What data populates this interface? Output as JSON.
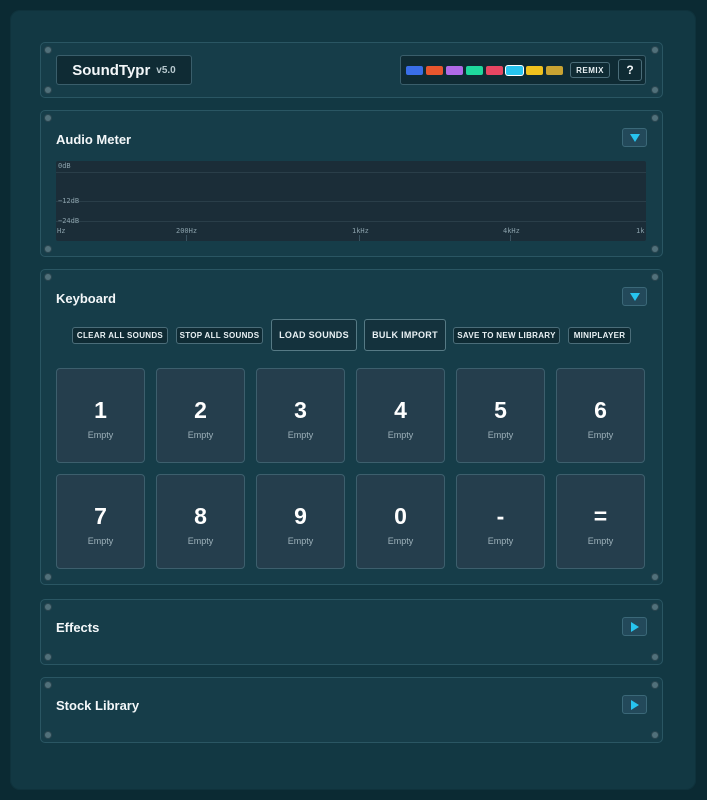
{
  "header": {
    "app_name": "SoundTypr",
    "version": "v5.0",
    "swatches": [
      "#3a6ee8",
      "#e8562e",
      "#b06ae8",
      "#1fd99d",
      "#e84663",
      "#27c4ef",
      "#f0c21e",
      "#c9a332"
    ],
    "selected_swatch": 5,
    "remix_label": "REMIX",
    "help_label": "?"
  },
  "audio_meter": {
    "title": "Audio Meter",
    "db_labels": [
      "0dB",
      "−12dB",
      "−24dB"
    ],
    "freq_labels": [
      "Hz",
      "200Hz",
      "1kHz",
      "4kHz",
      "1k"
    ]
  },
  "keyboard": {
    "title": "Keyboard",
    "actions": [
      "CLEAR ALL SOUNDS",
      "STOP ALL SOUNDS",
      "LOAD SOUNDS",
      "BULK IMPORT",
      "SAVE TO NEW LIBRARY",
      "MINIPLAYER"
    ],
    "keys": [
      {
        "label": "1",
        "status": "Empty"
      },
      {
        "label": "2",
        "status": "Empty"
      },
      {
        "label": "3",
        "status": "Empty"
      },
      {
        "label": "4",
        "status": "Empty"
      },
      {
        "label": "5",
        "status": "Empty"
      },
      {
        "label": "6",
        "status": "Empty"
      },
      {
        "label": "7",
        "status": "Empty"
      },
      {
        "label": "8",
        "status": "Empty"
      },
      {
        "label": "9",
        "status": "Empty"
      },
      {
        "label": "0",
        "status": "Empty"
      },
      {
        "label": "-",
        "status": "Empty"
      },
      {
        "label": "=",
        "status": "Empty"
      }
    ]
  },
  "effects": {
    "title": "Effects"
  },
  "stock_library": {
    "title": "Stock Library"
  }
}
